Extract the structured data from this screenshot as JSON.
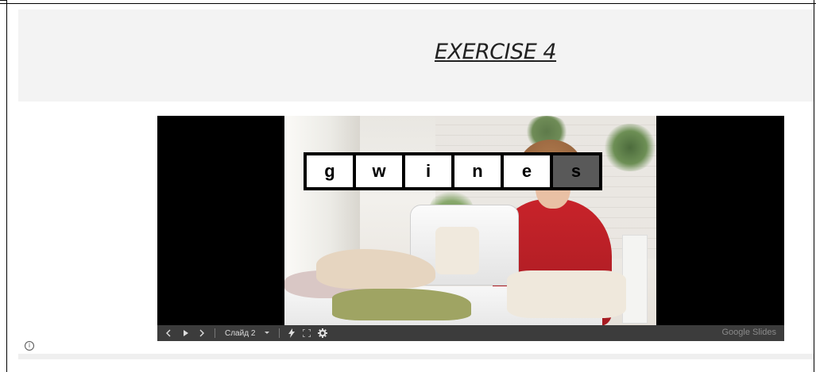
{
  "header": {
    "title": "EXERCISE 4"
  },
  "slide": {
    "letters": [
      "g",
      "w",
      "i",
      "n",
      "e",
      "s"
    ]
  },
  "player": {
    "prev_icon": "chevron-left-icon",
    "play_icon": "play-icon",
    "next_icon": "chevron-right-icon",
    "slide_label": "Слайд 2",
    "dropdown_icon": "caret-down-icon",
    "edit_icon": "pencil-icon",
    "fullscreen_icon": "fullscreen-icon",
    "settings_icon": "gear-icon",
    "brand": "Google Slides"
  },
  "footer": {
    "info_icon": "info-icon"
  }
}
